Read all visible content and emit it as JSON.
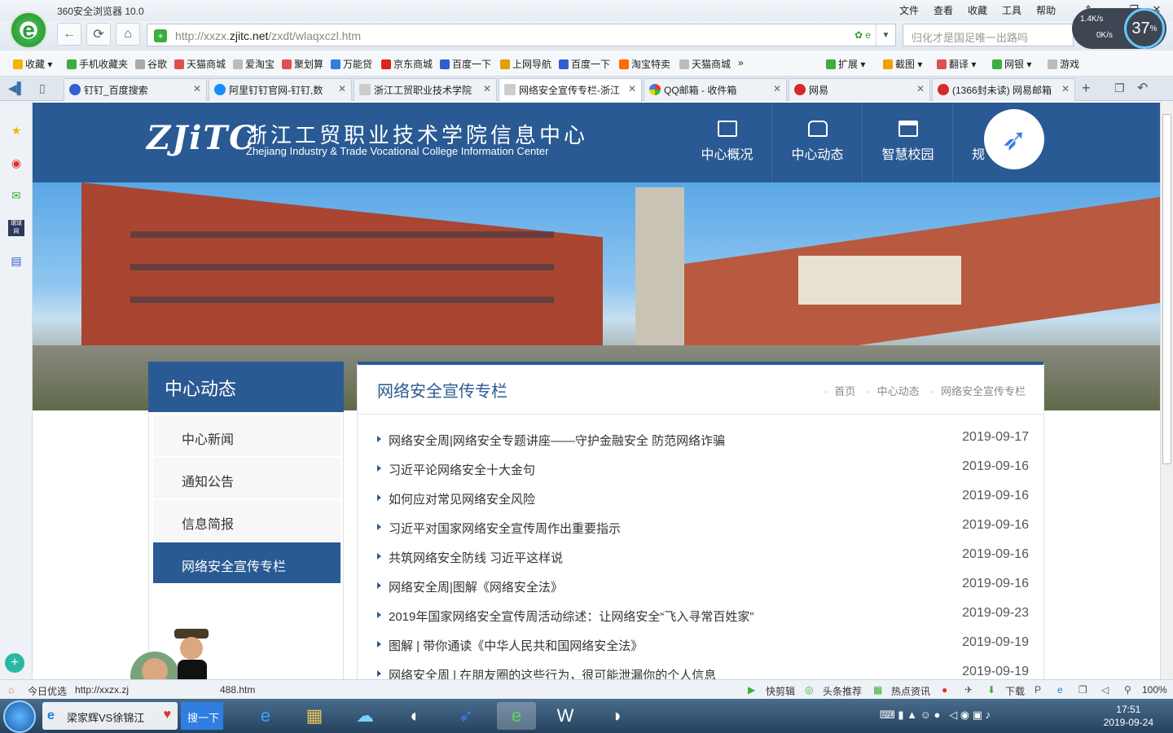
{
  "browser": {
    "title": "360安全浏览器 10.0",
    "menus": [
      "文件",
      "查看",
      "收藏",
      "工具",
      "帮助"
    ],
    "url_prefix": "http://xxzx.",
    "url_domain": "zjitc.net",
    "url_path": "/zxdt/wlaqxczl.htm",
    "search_placeholder": "归化才是国足唯一出路吗",
    "speed_up": "1.4K/s",
    "speed_down": "0K/s",
    "speed_pct": "37",
    "bookmarks": [
      "收藏",
      "手机收藏夹",
      "谷歌",
      "天猫商城",
      "爱淘宝",
      "聚划算",
      "万能贷",
      "京东商城",
      "百度一下",
      "上网导航",
      "百度一下",
      "淘宝特卖",
      "天猫商城"
    ],
    "toolbar_right": [
      "扩展",
      "截图",
      "翻译",
      "网银",
      "游戏"
    ],
    "tabs": [
      "钉钉_百度搜索",
      "阿里钉钉官网-钉钉,数",
      "浙江工贸职业技术学院",
      "网络安全宣传专栏-浙江",
      "QQ邮箱 - 收件箱",
      "网易",
      "(1366封未读) 网易邮箱"
    ]
  },
  "site": {
    "logo_abbr": "ZJiTC",
    "name_cn": "浙江工贸职业技术学院信息中心",
    "name_en": "Zhejiang Industry & Trade Vocational College Information Center",
    "nav": [
      "中心概况",
      "中心动态",
      "智慧校园",
      "规"
    ],
    "section_title": "中心动态",
    "left_nav": [
      "中心新闻",
      "通知公告",
      "信息简报",
      "网络安全宣传专栏"
    ],
    "main_title": "网络安全宣传专栏",
    "breadcrumb": [
      "首页",
      "中心动态",
      "网络安全宣传专栏"
    ],
    "articles": [
      {
        "title": "网络安全周|网络安全专题讲座——守护金融安全 防范网络诈骗",
        "date": "2019-09-17"
      },
      {
        "title": "习近平论网络安全十大金句",
        "date": "2019-09-16"
      },
      {
        "title": "如何应对常见网络安全风险",
        "date": "2019-09-16"
      },
      {
        "title": "习近平对国家网络安全宣传周作出重要指示",
        "date": "2019-09-16"
      },
      {
        "title": "共筑网络安全防线 习近平这样说",
        "date": "2019-09-16"
      },
      {
        "title": "网络安全周|图解《网络安全法》",
        "date": "2019-09-16"
      },
      {
        "title": "2019年国家网络安全宣传周活动综述：让网络安全“飞入寻常百姓家”",
        "date": "2019-09-23"
      },
      {
        "title": "图解 | 带你通读《中华人民共和国网络安全法》",
        "date": "2019-09-19"
      },
      {
        "title": "网络安全周 | 在朋友圈的这些行为，很可能泄漏你的个人信息",
        "date": "2019-09-19"
      }
    ]
  },
  "statusbar": {
    "left_label": "今日优选",
    "hover_url": "http://xxzx.zj",
    "hover_url_tail": "488.htm",
    "items": [
      "快剪辑",
      "头条推荐",
      "热点资讯",
      "下载"
    ],
    "zoom": "100%"
  },
  "taskbar": {
    "task_label": "梁家辉VS徐锦江",
    "search_btn": "搜一下",
    "time": "17:51",
    "date": "2019-09-24"
  },
  "colors": {
    "brand_blue": "#2a5a93",
    "browser_green": "#3dad3d"
  }
}
